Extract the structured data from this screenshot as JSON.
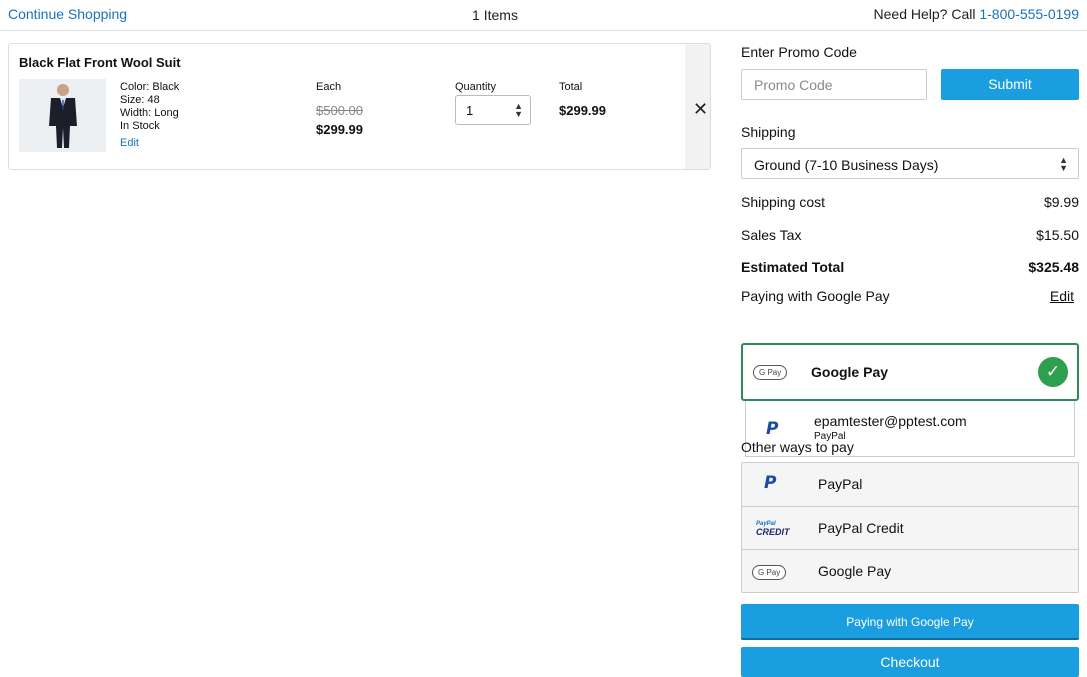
{
  "header": {
    "continue_label": "Continue Shopping",
    "items_count": "1 Items",
    "help_text": "Need Help? Call ",
    "help_phone": "1-800-555-0199"
  },
  "cart": {
    "item": {
      "title": "Black Flat Front Wool Suit",
      "color": "Color: Black",
      "size": "Size: 48",
      "width": "Width: Long",
      "stock": "In Stock",
      "edit_label": "Edit",
      "each_label": "Each",
      "price_original": "$500.00",
      "price_sale": "$299.99",
      "quantity_label": "Quantity",
      "quantity_value": "1",
      "total_label": "Total",
      "total_value": "$299.99",
      "remove_symbol": "✕"
    }
  },
  "promo": {
    "label": "Enter Promo Code",
    "placeholder": "Promo Code",
    "submit_label": "Submit"
  },
  "shipping": {
    "label": "Shipping",
    "selected": "Ground (7-10 Business Days)"
  },
  "summary": {
    "shipping_cost_label": "Shipping cost",
    "shipping_cost_value": "$9.99",
    "sales_tax_label": "Sales Tax",
    "sales_tax_value": "$15.50",
    "estimated_total_label": "Estimated Total",
    "estimated_total_value": "$325.48"
  },
  "payment": {
    "paying_with_label": "Paying with Google Pay",
    "edit_label": "Edit",
    "selected_method": {
      "chip": "G Pay",
      "name": "Google Pay",
      "check": "✓"
    },
    "paypal_account": {
      "email": "epamtester@pptest.com",
      "provider": "PayPal"
    },
    "other_ways_label": "Other ways to pay",
    "other_options": [
      {
        "label": "PayPal",
        "icon": "paypal-icon"
      },
      {
        "label": "PayPal Credit",
        "icon": "paypal-credit-icon",
        "logo_top": "PayPal",
        "logo_bottom": "CREDIT"
      },
      {
        "label": "Google Pay",
        "icon": "google-pay-icon",
        "chip": "G Pay"
      }
    ]
  },
  "actions": {
    "paying_button": "Paying with Google Pay",
    "checkout_button": "Checkout"
  },
  "colors": {
    "accent_blue": "#1a9ee0",
    "link_blue": "#1a73b8",
    "success_green": "#2e9f4f",
    "paypal_blue": "#1b4aa8"
  }
}
